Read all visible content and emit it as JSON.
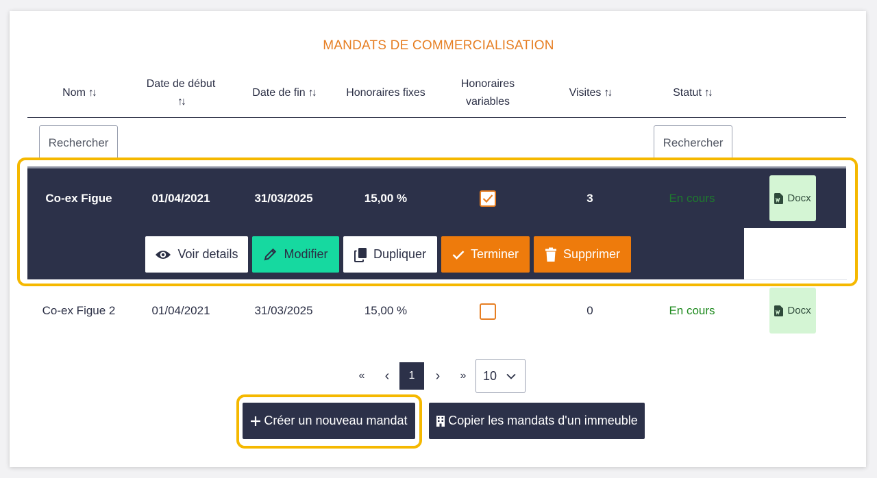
{
  "title": "MANDATS DE COMMERCIALISATION",
  "sort_glyph": "↑↓",
  "columns": {
    "nom": "Nom",
    "date_debut": "Date de début",
    "date_fin": "Date de fin",
    "honoraires_fixes": "Honoraires fixes",
    "honoraires_variables_1": "Honoraires",
    "honoraires_variables_2": "variables",
    "visites": "Visites",
    "statut": "Statut"
  },
  "search": {
    "nom_label": "Rechercher",
    "statut_label": "Rechercher"
  },
  "rows": [
    {
      "nom": "Co-ex Figue",
      "date_debut": "01/04/2021",
      "date_fin": "31/03/2025",
      "honoraires_fixes": "15,00 %",
      "honoraires_variables_checked": true,
      "visites": "3",
      "statut": "En cours",
      "docx_label": "Docx"
    },
    {
      "nom": "Co-ex Figue 2",
      "date_debut": "01/04/2021",
      "date_fin": "31/03/2025",
      "honoraires_fixes": "15,00 %",
      "honoraires_variables_checked": false,
      "visites": "0",
      "statut": "En cours",
      "docx_label": "Docx"
    }
  ],
  "row_actions": {
    "voir_details": "Voir details",
    "modifier": "Modifier",
    "dupliquer": "Dupliquer",
    "terminer": "Terminer",
    "supprimer": "Supprimer"
  },
  "pagination": {
    "first": "«",
    "prev": "‹",
    "current_page": "1",
    "next": "›",
    "last": "»",
    "page_size": "10"
  },
  "actions": {
    "create_mandate": "Créer un nouveau mandat",
    "copy_mandates": "Copier les mandats d'un immeuble"
  },
  "colors": {
    "accent_orange": "#e67e22",
    "dark_navy": "#2c3149",
    "green_button": "#16d9a0",
    "highlight": "#f5b800",
    "status_green": "#1e8a1e"
  },
  "icons": {
    "voir_details": "eye-icon",
    "modifier": "pencil-icon",
    "dupliquer": "copy-icon",
    "terminer": "check-icon",
    "supprimer": "trash-icon",
    "docx": "word-file-icon",
    "create": "plus-icon",
    "copy_building": "building-icon",
    "page_size": "chevron-down-icon"
  }
}
